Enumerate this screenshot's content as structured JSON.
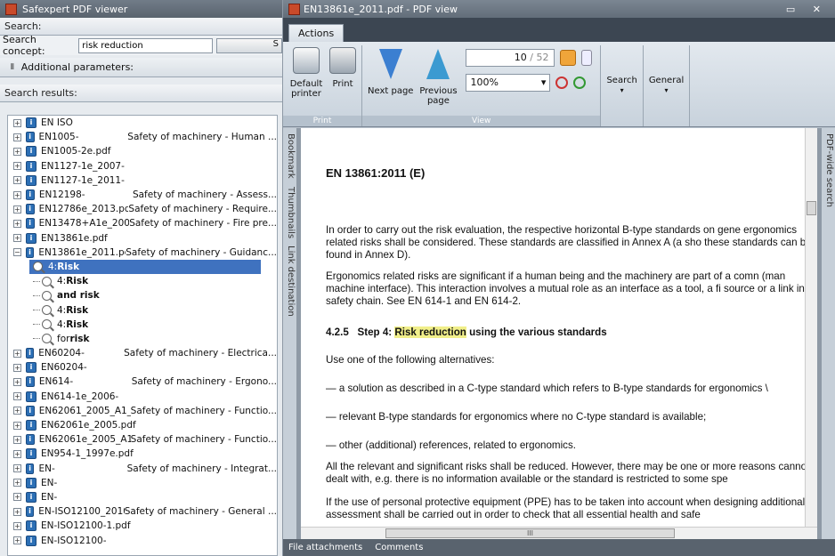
{
  "left": {
    "title": "Safexpert PDF viewer",
    "search_header": "Search:",
    "search_concept_label": "Search concept:",
    "search_concept_value": "risk reduction",
    "search_button": "S",
    "additional_params": "Additional parameters:",
    "results_header": "Search results:",
    "results_top": [
      {
        "name": "EN ISO",
        "desc": ""
      },
      {
        "name": "EN1005-",
        "desc": "Safety of machinery - Human ..."
      },
      {
        "name": "EN1005-2e.pdf",
        "desc": ""
      },
      {
        "name": "EN1127-1e_2007-",
        "desc": ""
      },
      {
        "name": "EN1127-1e_2011-",
        "desc": ""
      },
      {
        "name": "EN12198-",
        "desc": "Safety of machinery - Assess..."
      },
      {
        "name": "EN12786e_2013.pdf",
        "desc": "Safety of machinery - Require..."
      },
      {
        "name": "EN13478+A1e_2008",
        "desc": "Safety of machinery - Fire pre..."
      },
      {
        "name": "EN13861e.pdf",
        "desc": ""
      },
      {
        "name": "EN13861e_2011.pdf",
        "desc": "Safety of machinery - Guidanc..."
      }
    ],
    "hits": [
      {
        "prefix": "4: ",
        "bold": "Risk",
        "selected": true
      },
      {
        "prefix": "4: ",
        "bold": "Risk",
        "selected": false
      },
      {
        "prefix": "",
        "bold": "and risk",
        "selected": false
      },
      {
        "prefix": "4: ",
        "bold": "Risk",
        "selected": false
      },
      {
        "prefix": "4: ",
        "bold": "Risk",
        "selected": false
      },
      {
        "prefix": "for ",
        "bold": "risk",
        "selected": false
      }
    ],
    "results_bottom": [
      {
        "name": "EN60204-",
        "desc": "Safety of machinery - Electrica..."
      },
      {
        "name": "EN60204-",
        "desc": ""
      },
      {
        "name": "EN614-",
        "desc": "Safety of machinery - Ergono..."
      },
      {
        "name": "EN614-1e_2006-",
        "desc": ""
      },
      {
        "name": "EN62061_2005_A1_",
        "desc": "Safety of machinery - Functio..."
      },
      {
        "name": "EN62061e_2005.pdf",
        "desc": ""
      },
      {
        "name": "EN62061e_2005_A1",
        "desc": "Safety of machinery - Functio..."
      },
      {
        "name": "EN954-1_1997e.pdf",
        "desc": ""
      },
      {
        "name": "EN-",
        "desc": "Safety of machinery - Integrat..."
      },
      {
        "name": "EN-",
        "desc": ""
      },
      {
        "name": "EN-",
        "desc": ""
      },
      {
        "name": "EN-ISO12100_2010-",
        "desc": "Safety of machinery - General ..."
      },
      {
        "name": "EN-ISO12100-1.pdf",
        "desc": ""
      },
      {
        "name": "EN-ISO12100-",
        "desc": ""
      }
    ]
  },
  "viewer": {
    "title": "EN13861e_2011.pdf - PDF view",
    "window_controls": "▭ ✕",
    "tab": "Actions",
    "groups": {
      "print": "Print",
      "view": "View"
    },
    "buttons": {
      "default_printer": "Default printer",
      "print": "Print",
      "next_page": "Next page",
      "previous_page": "Previous page",
      "search": "Search",
      "general": "General"
    },
    "page_current": "10",
    "page_total": "/ 52",
    "zoom": "100%",
    "side_tabs": {
      "bookmark": "Bookmark",
      "thumbnails": "Thumbnails",
      "link_destination": "Link destination",
      "pdf_wide_search": "PDF-wide search"
    },
    "bottom_tabs": [
      "File attachments",
      "Comments"
    ]
  },
  "document": {
    "heading": "EN 13861:2011 (E)",
    "p1": "In order to carry out the risk evaluation, the respective horizontal B-type standards on gene ergonomics related risks shall be considered. These standards are classified in Annex A (a sho these standards can be found in Annex D).",
    "p2": "Ergonomics related risks are significant if a human being and the machinery are part of a comn (man machine interface). This interaction involves a mutual role as an interface as a tool, a fi source or a link in a safety chain. See EN 614-1 and EN 614-2.",
    "section_num": "4.2.5",
    "section_pre": "Step 4: ",
    "section_hl": "Risk reduction",
    "section_post": " using the various standards",
    "p3": "Use one of the following alternatives:",
    "b1": "—  a solution as described in a C-type standard which refers to B-type standards for ergonomics \\",
    "b2": "—  relevant B-type standards for ergonomics where no C-type standard is available;",
    "b3": "—  other (additional) references, related to ergonomics.",
    "p4": "All the relevant and significant risks shall be reduced. However, there may be one or more reasons cannot be dealt with, e.g. there is no information available or the standard is restricted to some spe",
    "p5": "If the use of personal protective equipment (PPE) has to be taken into account when designing additional risk assessment shall be carried out in order to check that all essential health and safe",
    "hscroll_grip": "III"
  },
  "colors": {
    "highlight": "#f1ef8a",
    "selection": "#3f72bf"
  }
}
